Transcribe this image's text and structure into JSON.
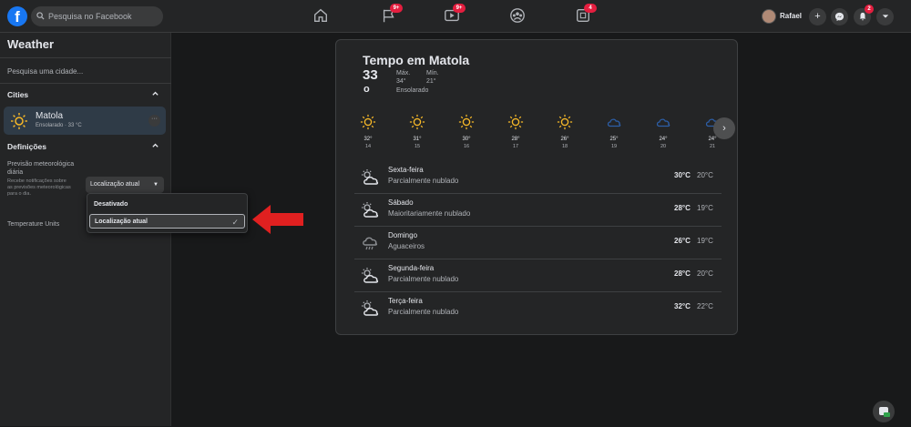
{
  "topbar": {
    "logo": "f",
    "search_placeholder": "Pesquisa no Facebook",
    "nav": [
      {
        "icon": "home-icon",
        "badge": ""
      },
      {
        "icon": "flag-icon",
        "badge": "9+"
      },
      {
        "icon": "video-icon",
        "badge": "9+"
      },
      {
        "icon": "groups-icon",
        "badge": ""
      },
      {
        "icon": "gaming-icon",
        "badge": "4"
      }
    ],
    "profile_name": "Rafael",
    "create_label": "+",
    "notifications_badge": "2"
  },
  "sidebar": {
    "title": "Weather",
    "search_placeholder": "Pesquisa uma cidade...",
    "cities_header": "Cities",
    "city": {
      "name": "Matola",
      "sub": "Ensolarado · 33 °C",
      "more": "···"
    },
    "settings_header": "Definições",
    "forecast_label": "Previsão meteorológica diária",
    "forecast_hint": "Recebe notificações sobre as previsões meteorológicas para o dia.",
    "location_select": "Localização atual",
    "temperature_units": "Temperature Units"
  },
  "dropdown": {
    "options": [
      "Desativado",
      "Localização atual"
    ],
    "selected_index": 1,
    "check": "✓"
  },
  "weather": {
    "title": "Tempo em Matola",
    "current_temp": "33",
    "current_deg": "o",
    "max_label": "Máx.",
    "max_value": "34°",
    "min_label": "Mín.",
    "min_value": "21°",
    "condition": "Ensolarado",
    "hourly": [
      {
        "temp": "32°",
        "day": "14",
        "icon": "sun-icon"
      },
      {
        "temp": "31°",
        "day": "15",
        "icon": "sun-icon"
      },
      {
        "temp": "30°",
        "day": "16",
        "icon": "sun-icon"
      },
      {
        "temp": "28°",
        "day": "17",
        "icon": "sun-icon"
      },
      {
        "temp": "26°",
        "day": "18",
        "icon": "sun-icon"
      },
      {
        "temp": "25°",
        "day": "19",
        "icon": "cloud-icon"
      },
      {
        "temp": "24°",
        "day": "20",
        "icon": "cloud-icon"
      },
      {
        "temp": "24°",
        "day": "21",
        "icon": "cloud-icon"
      }
    ],
    "next_label": "›",
    "daily": [
      {
        "name": "Sexta-feira",
        "cond": "Parcialmente nublado",
        "hi": "30°C",
        "lo": "20°C",
        "icon": "partly-cloudy-icon"
      },
      {
        "name": "Sábado",
        "cond": "Maioritariamente nublado",
        "hi": "28°C",
        "lo": "19°C",
        "icon": "partly-cloudy-icon"
      },
      {
        "name": "Domingo",
        "cond": "Aguaceiros",
        "hi": "26°C",
        "lo": "19°C",
        "icon": "rain-icon"
      },
      {
        "name": "Segunda-feira",
        "cond": "Parcialmente nublado",
        "hi": "28°C",
        "lo": "20°C",
        "icon": "partly-cloudy-icon"
      },
      {
        "name": "Terça-feira",
        "cond": "Parcialmente nublado",
        "hi": "32°C",
        "lo": "22°C",
        "icon": "partly-cloudy-icon"
      }
    ]
  },
  "colors": {
    "accent": "#1877f2",
    "badge": "#e41e3f",
    "arrow": "#e02020",
    "sun": "#f7b928",
    "cloud": "#2d5fa8"
  }
}
